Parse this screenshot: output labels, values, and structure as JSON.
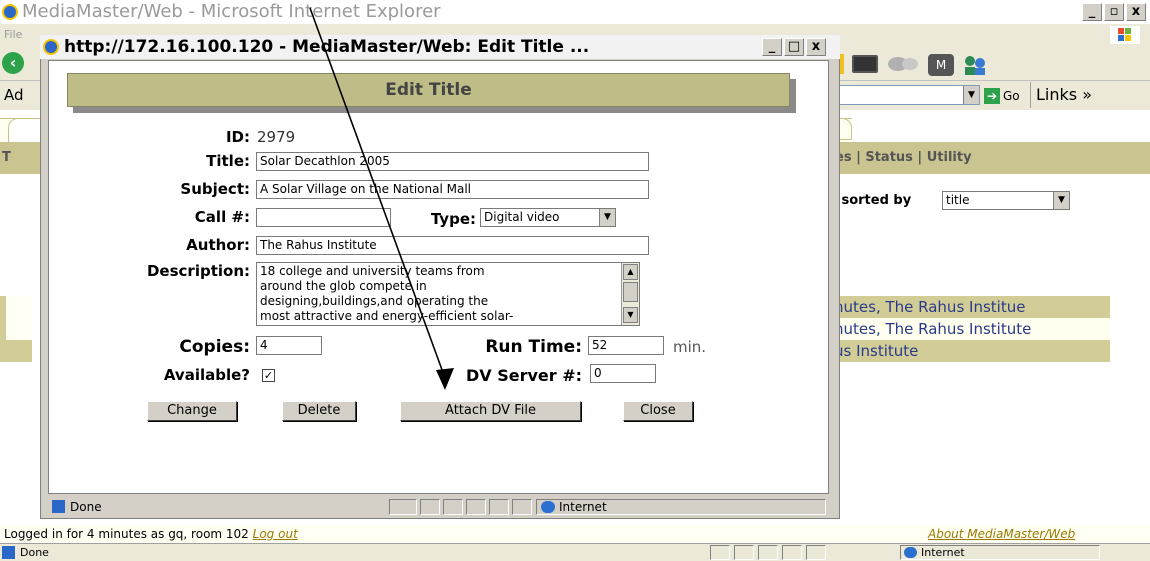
{
  "main_window": {
    "title": "MediaMaster/Web - Microsoft Internet Explorer",
    "menu_file": "File",
    "address_label": "Ad",
    "go_label": "Go",
    "links_label": "Links »",
    "buttons": [
      "_",
      "▫",
      "x"
    ]
  },
  "page": {
    "nav_links": "es | Status | Utility",
    "sorted_by_label": ", sorted by",
    "sort_select": "title",
    "rows": [
      "nutes, The Rahus Institue",
      "nutes, The Rahus Institute",
      "us Institute"
    ],
    "row_colors": [
      "#d2cd97",
      "#fffff0",
      "#d2cd97"
    ],
    "footer_left": "Logged in for 4 minutes as gq, room 102",
    "logout": "Log out",
    "about": "About MediaMaster/Web",
    "status_done": "Done",
    "status_zone": "Internet"
  },
  "dialog": {
    "title": "http://172.16.100.120 - MediaMaster/Web: Edit Title ...",
    "heading": "Edit Title",
    "id_label": "ID:",
    "id_value": "2979",
    "title_label": "Title:",
    "title_value": "Solar Decathlon 2005",
    "subject_label": "Subject:",
    "subject_value": "A Solar Village on the National Mall",
    "call_label": "Call #:",
    "call_value": "",
    "type_label": "Type:",
    "type_value": "Digital video",
    "author_label": "Author:",
    "author_value": "The Rahus Institute",
    "description_label": "Description:",
    "description_lines": [
      "18 college and university teams from",
      "around the glob compete in",
      "designing,buildings,and operating the",
      "most attractive and energy-efficient solar-"
    ],
    "copies_label": "Copies:",
    "copies_value": "4",
    "runtime_label": "Run Time:",
    "runtime_value": "52",
    "runtime_unit": "min.",
    "available_label": "Available?",
    "available_checked": true,
    "dvserver_label": "DV Server #:",
    "dvserver_value": "0",
    "buttons": {
      "change": "Change",
      "delete": "Delete",
      "attach": "Attach DV File",
      "close": "Close"
    },
    "status_done": "Done",
    "status_zone": "Internet"
  }
}
